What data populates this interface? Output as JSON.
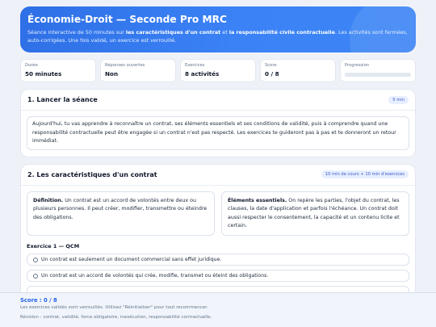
{
  "hero": {
    "title": "Économie-Droit — Seconde Pro MRC",
    "desc_prefix": "Séance interactive de 50 minutes sur ",
    "desc_bold1": "les caractéristiques d'un contrat",
    "desc_mid": " et ",
    "desc_bold2": "la responsabilité civile contractuelle",
    "desc_suffix": ". Les activités sont fermées, auto-corrigées. Une fois validé, un exercice est verrouillé."
  },
  "stats": [
    {
      "label": "Durée",
      "value": "50 minutes"
    },
    {
      "label": "Réponses ouvertes",
      "value": "Non"
    },
    {
      "label": "Exercices",
      "value": "8 activités"
    },
    {
      "label": "Score",
      "value": "0 / 8"
    },
    {
      "label": "Progression",
      "progress": 0
    }
  ],
  "section1": {
    "title": "1. Lancer la séance",
    "badge": "5 min",
    "text": "Aujourd'hui, tu vas apprendre à reconnaître un contrat, ses éléments essentiels et ses conditions de validité, puis à comprendre quand une responsabilité contractuelle peut être engagée si un contrat n'est pas respecté. Les exercices te guideront pas à pas et te donneront un retour immédiat."
  },
  "section2": {
    "title": "2. Les caractéristiques d'un contrat",
    "badge": "10 min de cours + 10 min d'exercices",
    "def_label": "Définition.",
    "def_text": " Un contrat est un accord de volontés entre deux ou plusieurs personnes. Il peut créer, modifier, transmettre ou éteindre des obligations.",
    "ess_label": "Éléments essentiels.",
    "ess_text": " On repère les parties, l'objet du contrat, les clauses, la date d'application et parfois l'échéance. Un contrat doit aussi respecter le consentement, la capacité et un contenu licite et certain.",
    "exercise_title": "Exercice 1 — QCM",
    "options": [
      "Un contrat est seulement un document commercial sans effet juridique.",
      "Un contrat est un accord de volontés qui crée, modifie, transmet ou éteint des obligations."
    ]
  },
  "footer": {
    "score": "Score : 0 / 8",
    "hint": "Les exercices validés sont verrouillés. Utilisez \"Réinitialiser\" pour tout recommencer.",
    "review": "Révision : contrat, validité, force obligatoire, inexécution, responsabilité contractuelle."
  },
  "colors": {
    "accent": "#3b82f6",
    "badge_bg": "#e7eeff",
    "score_text": "#2563eb"
  }
}
